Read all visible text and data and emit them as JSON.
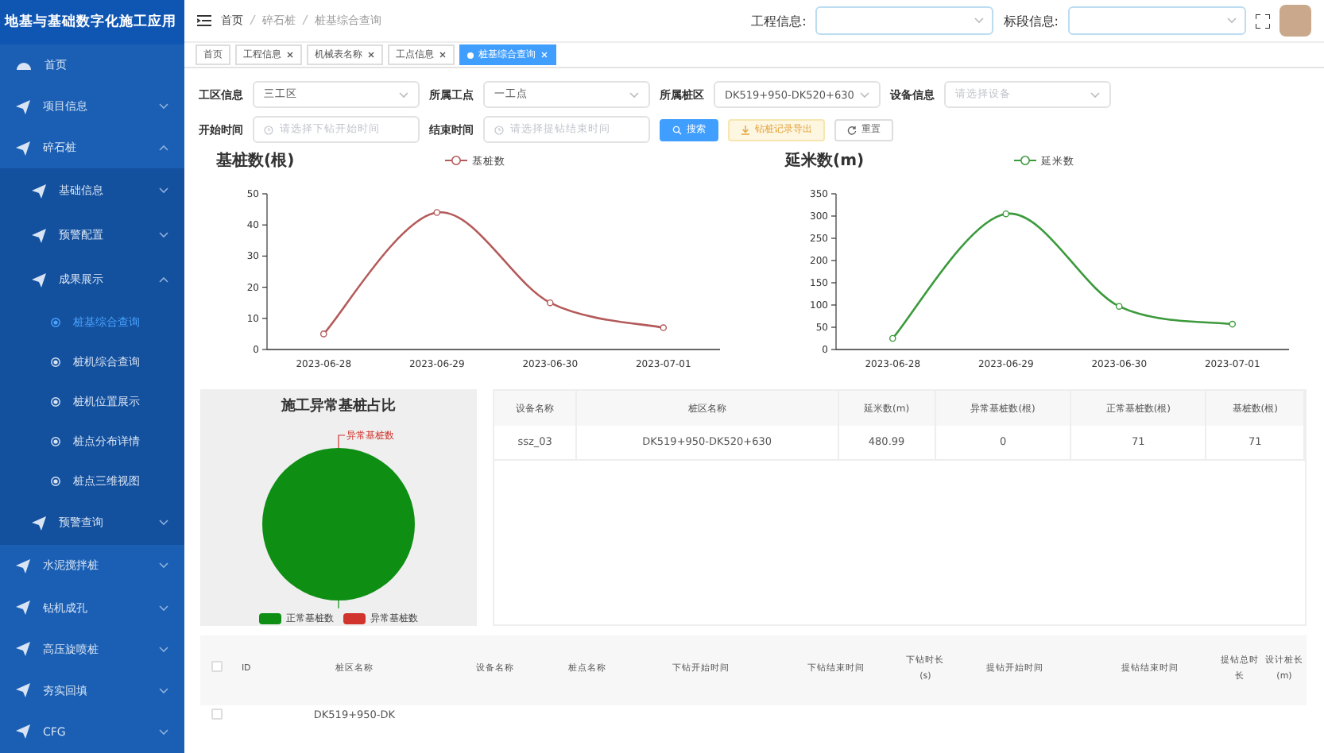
{
  "app_title": "地基与基础数字化施工应用",
  "sidebar": {
    "items": [
      {
        "label": "首页",
        "selected": false
      },
      {
        "label": "项目信息",
        "selected": false,
        "expanded": false
      },
      {
        "label": "碎石桩",
        "selected": false,
        "expanded": true,
        "children": [
          {
            "label": "基础信息",
            "selected": false,
            "expanded": false
          },
          {
            "label": "预警配置",
            "selected": false,
            "expanded": false
          },
          {
            "label": "成果展示",
            "selected": false,
            "expanded": true,
            "children": [
              {
                "label": "桩基综合查询",
                "selected": true
              },
              {
                "label": "桩机综合查询",
                "selected": false
              },
              {
                "label": "桩机位置展示",
                "selected": false
              },
              {
                "label": "桩点分布详情",
                "selected": false
              },
              {
                "label": "桩点三维视图",
                "selected": false
              }
            ]
          },
          {
            "label": "预警查询",
            "selected": false,
            "expanded": false
          }
        ]
      },
      {
        "label": "水泥搅拌桩",
        "selected": false,
        "expanded": false
      },
      {
        "label": "钻机成孔",
        "selected": false,
        "expanded": false
      },
      {
        "label": "高压旋喷桩",
        "selected": false,
        "expanded": false
      },
      {
        "label": "夯实回填",
        "selected": false,
        "expanded": false
      },
      {
        "label": "CFG",
        "selected": false,
        "expanded": false
      }
    ]
  },
  "header": {
    "breadcrumb": [
      "首页",
      "碎石桩",
      "桩基综合查询"
    ],
    "selectors": [
      {
        "label": "工程信息:"
      },
      {
        "label": "标段信息:"
      }
    ]
  },
  "tags": [
    {
      "label": "首页",
      "selected": false,
      "closable": false
    },
    {
      "label": "工程信息",
      "selected": false,
      "closable": true
    },
    {
      "label": "机械表名称",
      "selected": false,
      "closable": true
    },
    {
      "label": "工点信息",
      "selected": false,
      "closable": true
    },
    {
      "label": "桩基综合查询",
      "selected": true,
      "closable": true
    }
  ],
  "filters": [
    [
      {
        "kind": "select",
        "label": "工区信息",
        "value": "三工区"
      },
      {
        "kind": "select",
        "label": "所属工点",
        "value": "一工点"
      },
      {
        "kind": "select",
        "label": "所属桩区",
        "value": "DK519+950-DK520+630"
      },
      {
        "kind": "select",
        "label": "设备信息",
        "placeholder": "请选择设备"
      }
    ],
    [
      {
        "kind": "date",
        "label": "开始时间",
        "placeholder": "请选择下钻开始时间"
      },
      {
        "kind": "date",
        "label": "结束时间",
        "placeholder": "请选择提钻结束时间"
      }
    ]
  ],
  "buttons": [
    {
      "kind": "search",
      "label": "搜索"
    },
    {
      "kind": "export",
      "label": "钻桩记录导出"
    },
    {
      "kind": "reset",
      "label": "重置"
    }
  ],
  "charts": [
    {
      "chart_data": {
        "type": "line",
        "title": "基桩数(根)",
        "categories": [
          "2023-06-28",
          "2023-06-29",
          "2023-06-30",
          "2023-07-01"
        ],
        "series": [
          {
            "name": "基桩数",
            "color": "#b45a5a",
            "marker": "circle",
            "values": [
              5,
              44,
              15,
              7
            ]
          }
        ],
        "ylim": [
          0,
          50
        ],
        "yticks": [
          0,
          10,
          20,
          30,
          40,
          50
        ]
      }
    },
    {
      "chart_data": {
        "type": "line",
        "title": "延米数(m)",
        "categories": [
          "2023-06-28",
          "2023-06-29",
          "2023-06-30",
          "2023-07-01"
        ],
        "series": [
          {
            "name": "延米数",
            "color": "#3c9a3c",
            "marker": "circle",
            "values": [
              25,
              305,
              97,
              57
            ]
          }
        ],
        "ylim": [
          0,
          350
        ],
        "yticks": [
          0,
          50,
          100,
          150,
          200,
          250,
          300,
          350
        ]
      }
    }
  ],
  "pie": {
    "chart_data": {
      "type": "pie",
      "title": "施工异常基桩占比",
      "categories": [
        "正常基桩数",
        "异常基桩数"
      ],
      "values": [
        100,
        0
      ]
    }
  },
  "summary_table": {
    "columns": [
      "设备名称",
      "桩区名称",
      "延米数(m)",
      "异常基桩数(根)",
      "正常基桩数(根)",
      "基桩数(根)"
    ],
    "rows": [
      [
        "ssz_03",
        "DK519+950-DK520+630",
        "480.99",
        "0",
        "71",
        "71"
      ]
    ]
  },
  "records_table": {
    "all_checked": false,
    "columns": [
      "ID",
      "桩区名称",
      "设备名称",
      "桩点名称",
      "下钻开始时间",
      "下钻结束时间",
      "下钻时长(s)",
      "提钻开始时间",
      "提钻结束时间",
      "提钻总时长",
      "设计桩长(m)"
    ],
    "rows": [
      {
        "checked": false,
        "cells": {
          "1": "DK519+950-DK"
        }
      }
    ]
  }
}
